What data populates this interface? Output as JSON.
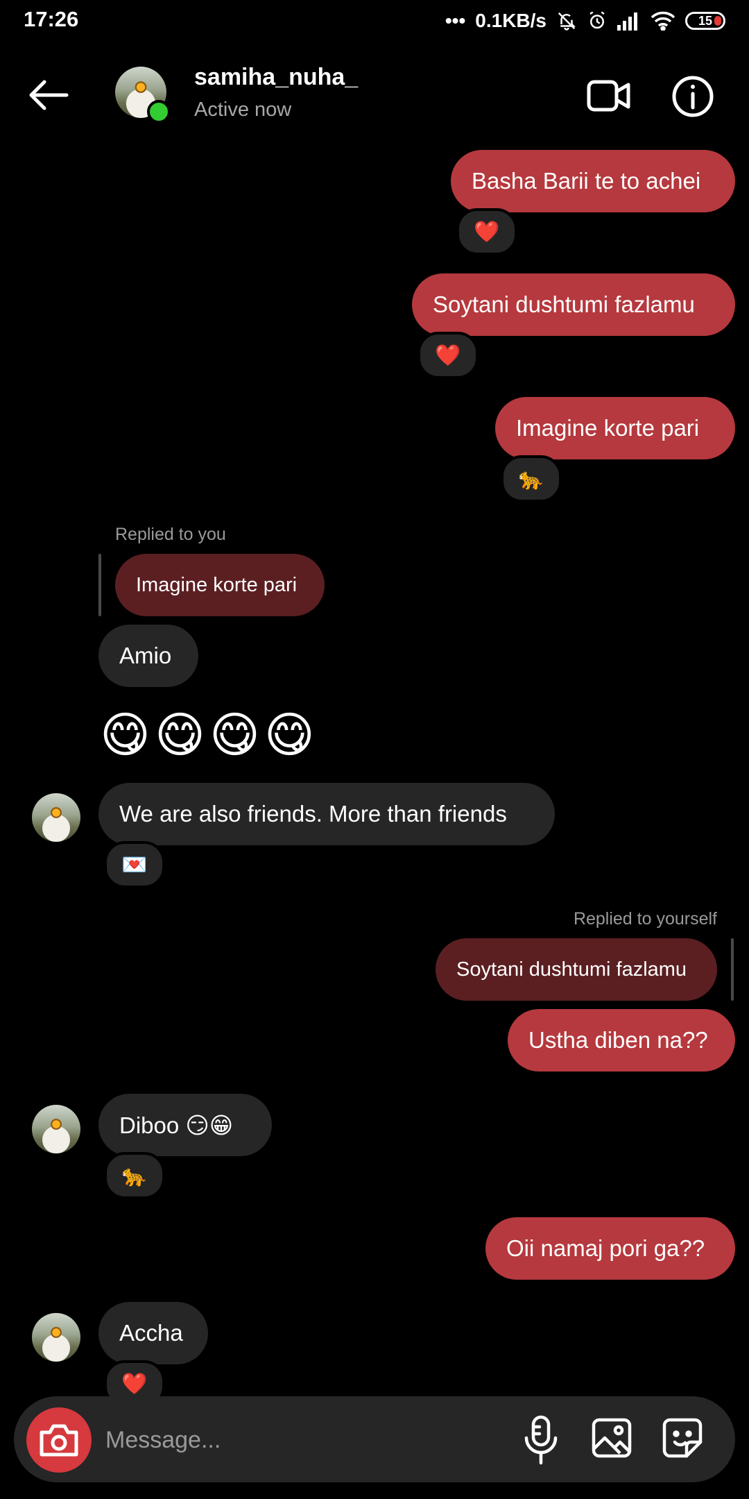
{
  "status_bar": {
    "time": "17:26",
    "network_speed": "0.1KB/s",
    "battery": "15"
  },
  "header": {
    "username": "samiha_nuha_",
    "status": "Active now"
  },
  "messages": [
    {
      "text": "Basha Barii te to achei",
      "reaction": "❤️"
    },
    {
      "text": "Soytani dushtumi fazlamu",
      "reaction": "❤️"
    },
    {
      "text": "Imagine korte pari",
      "reaction": "🐆"
    },
    {
      "replied_label": "Replied to you",
      "quoted": "Imagine korte pari"
    },
    {
      "text": "Amio"
    },
    {
      "text": "😋😋😋😋"
    },
    {
      "text": "We are also friends. More than friends",
      "reaction": "💌"
    },
    {
      "replied_label": "Replied to yourself",
      "quoted": "Soytani dushtumi fazlamu"
    },
    {
      "text": "Ustha diben na??"
    },
    {
      "text": "Diboo 😏😁",
      "reaction": "🐆"
    },
    {
      "text": "Oii namaj pori ga??"
    },
    {
      "text": "Accha",
      "reaction": "❤️"
    }
  ],
  "composer": {
    "placeholder": "Message..."
  },
  "colors": {
    "outgoing_bubble": "#b5393e",
    "incoming_bubble": "#262626",
    "quoted_bubble": "#5b1f22",
    "online": "#33cc33",
    "camera_button": "#d6393e"
  }
}
